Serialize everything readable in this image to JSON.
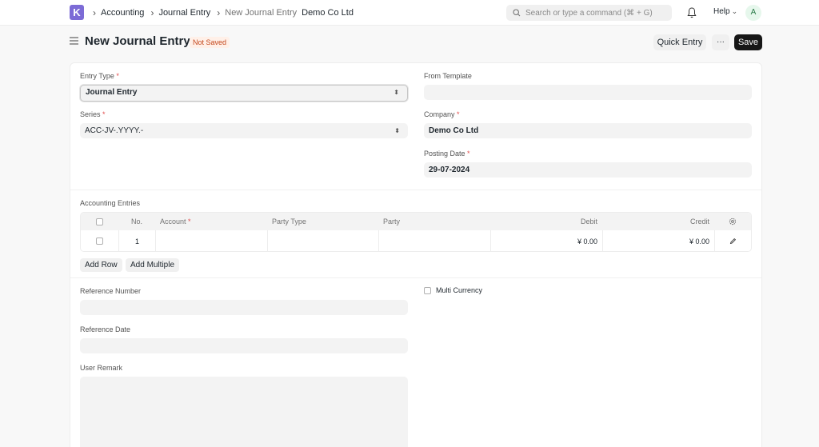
{
  "navbar": {
    "logo_letter": "K",
    "breadcrumbs": [
      "Accounting",
      "Journal Entry",
      "New Journal Entry"
    ],
    "company_crumb": "Demo Co Ltd",
    "search_placeholder": "Search or type a command (⌘ + G)",
    "help_label": "Help",
    "avatar_initial": "A"
  },
  "page": {
    "title": "New Journal Entry",
    "status": "Not Saved",
    "quick_entry_label": "Quick Entry",
    "more_label": "···",
    "save_label": "Save"
  },
  "form": {
    "entry_type": {
      "label": "Entry Type",
      "value": "Journal Entry"
    },
    "series": {
      "label": "Series",
      "value": "ACC-JV-.YYYY.-"
    },
    "from_template": {
      "label": "From Template",
      "value": ""
    },
    "company": {
      "label": "Company",
      "value": "Demo Co Ltd"
    },
    "posting_date": {
      "label": "Posting Date",
      "value": "29-07-2024"
    },
    "required_mark": "*"
  },
  "accounting_entries": {
    "label": "Accounting Entries",
    "columns": {
      "no": "No.",
      "account": "Account",
      "party_type": "Party Type",
      "party": "Party",
      "debit": "Debit",
      "credit": "Credit"
    },
    "rows": [
      {
        "no": "1",
        "account": "",
        "party_type": "",
        "party": "",
        "debit": "¥ 0.00",
        "credit": "¥ 0.00"
      }
    ],
    "add_row_label": "Add Row",
    "add_multiple_label": "Add Multiple"
  },
  "reference": {
    "reference_number_label": "Reference Number",
    "reference_date_label": "Reference Date",
    "user_remark_label": "User Remark",
    "multi_currency_label": "Multi Currency"
  },
  "colors": {
    "logo": "#7c6bd6",
    "primary_button": "#171717",
    "status_badge_text": "#c4481d",
    "required": "#e24c4c"
  },
  "icons": [
    "search-icon",
    "bell-icon",
    "hamburger-icon",
    "settings-gear-icon",
    "edit-pencil-icon",
    "chevron-right-icon",
    "up-down-icon"
  ]
}
